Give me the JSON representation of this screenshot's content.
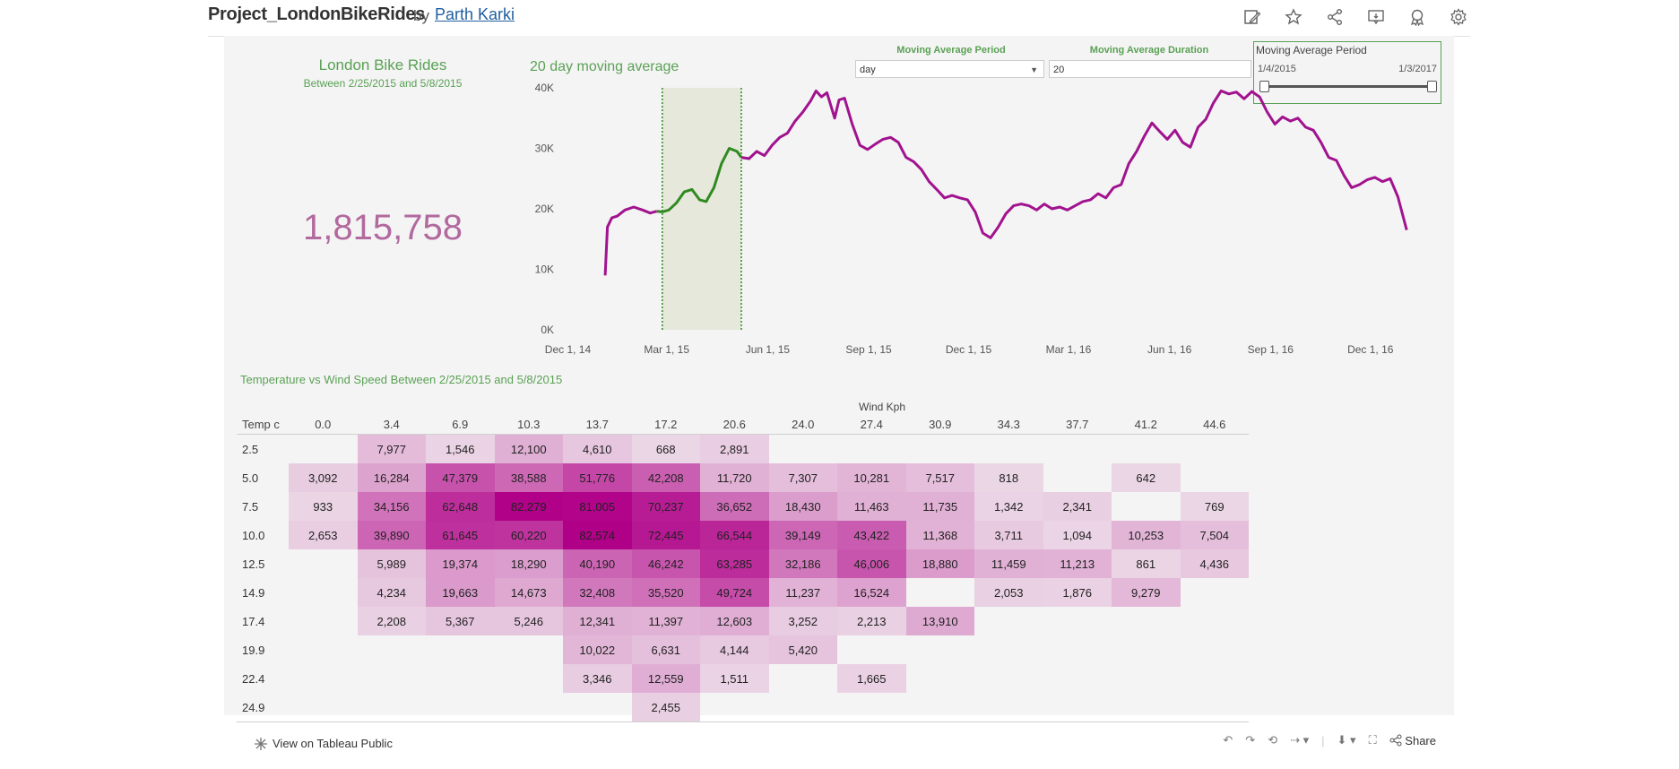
{
  "topbar": {
    "title": "Project_LondonBikeRides",
    "by": "by",
    "author": "Parth Karki"
  },
  "kpi": {
    "title": "London Bike Rides",
    "subtitle": "Between 2/25/2015 and 5/8/2015",
    "value": "1,815,758"
  },
  "line_title": "20 day moving average",
  "controls": {
    "period_label": "Moving Average Period",
    "period_value": "day",
    "duration_label": "Moving Average Duration",
    "duration_value": "20",
    "range_label": "Moving Average Period",
    "range_start": "1/4/2015",
    "range_end": "1/3/2017"
  },
  "heatmap": {
    "title": "Temperature vs Wind Speed Between 2/25/2015 and 5/8/2015",
    "col_header_label": "Wind Kph",
    "row_header_label": "Temp c"
  },
  "footer": {
    "view_label": "View on Tableau Public",
    "share_label": "Share"
  },
  "icons": [
    "edit-icon",
    "star-icon",
    "share-icon",
    "comment-icon",
    "badge-icon",
    "gear-icon"
  ],
  "colors": {
    "green": "#5aa155",
    "line_purple": "#a1128f",
    "highlight_green": "#2f8a1f",
    "kpi_purple": "#b2699e"
  },
  "chart_data": [
    {
      "type": "line",
      "title": "20 day moving average",
      "x_ticks": [
        "Dec 1, 14",
        "Mar 1, 15",
        "Jun 1, 15",
        "Sep 1, 15",
        "Dec 1, 15",
        "Mar 1, 16",
        "Jun 1, 16",
        "Sep 1, 16",
        "Dec 1, 16"
      ],
      "y_ticks": [
        "0K",
        "10K",
        "20K",
        "30K",
        "40K"
      ],
      "ylim": [
        0,
        40000
      ],
      "x_range": [
        "2014-11-20",
        "2017-01-20"
      ],
      "highlight": {
        "start": "2015-02-25",
        "end": "2015-05-08"
      },
      "series": [
        {
          "values": [
            [
              "2015-01-04",
              9000
            ],
            [
              "2015-01-06",
              17000
            ],
            [
              "2015-01-10",
              18500
            ],
            [
              "2015-01-15",
              18800
            ],
            [
              "2015-01-22",
              19800
            ],
            [
              "2015-01-30",
              20300
            ],
            [
              "2015-02-07",
              19800
            ],
            [
              "2015-02-14",
              19300
            ],
            [
              "2015-02-20",
              19600
            ],
            [
              "2015-02-25",
              19500
            ],
            [
              "2015-03-03",
              19800
            ],
            [
              "2015-03-10",
              21000
            ],
            [
              "2015-03-17",
              22800
            ],
            [
              "2015-03-24",
              23200
            ],
            [
              "2015-03-31",
              21500
            ],
            [
              "2015-04-06",
              21200
            ],
            [
              "2015-04-13",
              23500
            ],
            [
              "2015-04-20",
              27500
            ],
            [
              "2015-04-27",
              30000
            ],
            [
              "2015-05-04",
              29500
            ],
            [
              "2015-05-08",
              28500
            ],
            [
              "2015-05-15",
              28300
            ],
            [
              "2015-05-22",
              29500
            ],
            [
              "2015-05-29",
              28800
            ],
            [
              "2015-06-05",
              30500
            ],
            [
              "2015-06-12",
              31800
            ],
            [
              "2015-06-19",
              32500
            ],
            [
              "2015-06-26",
              34500
            ],
            [
              "2015-07-03",
              36000
            ],
            [
              "2015-07-10",
              37800
            ],
            [
              "2015-07-15",
              39500
            ],
            [
              "2015-07-20",
              38500
            ],
            [
              "2015-07-25",
              39200
            ],
            [
              "2015-08-01",
              35000
            ],
            [
              "2015-08-05",
              38000
            ],
            [
              "2015-08-10",
              38300
            ],
            [
              "2015-08-17",
              34000
            ],
            [
              "2015-08-24",
              30500
            ],
            [
              "2015-08-31",
              29800
            ],
            [
              "2015-09-07",
              30700
            ],
            [
              "2015-09-14",
              31500
            ],
            [
              "2015-09-21",
              31800
            ],
            [
              "2015-09-28",
              31000
            ],
            [
              "2015-10-05",
              28500
            ],
            [
              "2015-10-12",
              27800
            ],
            [
              "2015-10-19",
              26500
            ],
            [
              "2015-10-26",
              24500
            ],
            [
              "2015-11-02",
              23200
            ],
            [
              "2015-11-09",
              21800
            ],
            [
              "2015-11-16",
              22200
            ],
            [
              "2015-11-23",
              21800
            ],
            [
              "2015-11-30",
              21500
            ],
            [
              "2015-12-07",
              19500
            ],
            [
              "2015-12-14",
              16000
            ],
            [
              "2015-12-21",
              15200
            ],
            [
              "2015-12-28",
              17000
            ],
            [
              "2016-01-04",
              19200
            ],
            [
              "2016-01-11",
              20500
            ],
            [
              "2016-01-18",
              20800
            ],
            [
              "2016-01-25",
              20500
            ],
            [
              "2016-02-01",
              19800
            ],
            [
              "2016-02-08",
              20800
            ],
            [
              "2016-02-15",
              20000
            ],
            [
              "2016-02-22",
              20300
            ],
            [
              "2016-02-29",
              19800
            ],
            [
              "2016-03-07",
              20500
            ],
            [
              "2016-03-14",
              21200
            ],
            [
              "2016-03-21",
              21500
            ],
            [
              "2016-03-28",
              22500
            ],
            [
              "2016-04-04",
              21800
            ],
            [
              "2016-04-11",
              23500
            ],
            [
              "2016-04-18",
              24000
            ],
            [
              "2016-04-25",
              27500
            ],
            [
              "2016-05-02",
              29500
            ],
            [
              "2016-05-09",
              32000
            ],
            [
              "2016-05-16",
              34200
            ],
            [
              "2016-05-23",
              32800
            ],
            [
              "2016-05-30",
              31500
            ],
            [
              "2016-06-06",
              33000
            ],
            [
              "2016-06-13",
              31000
            ],
            [
              "2016-06-20",
              30200
            ],
            [
              "2016-06-27",
              33500
            ],
            [
              "2016-07-04",
              34800
            ],
            [
              "2016-07-11",
              37500
            ],
            [
              "2016-07-18",
              39500
            ],
            [
              "2016-07-25",
              39000
            ],
            [
              "2016-08-01",
              39300
            ],
            [
              "2016-08-08",
              38200
            ],
            [
              "2016-08-15",
              39400
            ],
            [
              "2016-08-22",
              38500
            ],
            [
              "2016-08-29",
              36000
            ],
            [
              "2016-09-05",
              34000
            ],
            [
              "2016-09-12",
              35200
            ],
            [
              "2016-09-19",
              34500
            ],
            [
              "2016-09-26",
              35000
            ],
            [
              "2016-10-03",
              33500
            ],
            [
              "2016-10-10",
              33000
            ],
            [
              "2016-10-17",
              31000
            ],
            [
              "2016-10-24",
              28500
            ],
            [
              "2016-10-31",
              28000
            ],
            [
              "2016-11-07",
              25500
            ],
            [
              "2016-11-14",
              23500
            ],
            [
              "2016-11-21",
              24000
            ],
            [
              "2016-11-28",
              24800
            ],
            [
              "2016-12-05",
              25200
            ],
            [
              "2016-12-12",
              24500
            ],
            [
              "2016-12-19",
              25000
            ],
            [
              "2016-12-26",
              22000
            ],
            [
              "2017-01-03",
              16500
            ]
          ]
        }
      ]
    },
    {
      "type": "heatmap",
      "title": "Temperature vs Wind Speed Between 2/25/2015 and 5/8/2015",
      "xlabel": "Wind Kph",
      "ylabel": "Temp c",
      "x": [
        "0.0",
        "3.4",
        "6.9",
        "10.3",
        "13.7",
        "17.2",
        "20.6",
        "24.0",
        "27.4",
        "30.9",
        "34.3",
        "37.7",
        "41.2",
        "44.6"
      ],
      "y": [
        "2.5",
        "5.0",
        "7.5",
        "10.0",
        "12.5",
        "14.9",
        "17.4",
        "19.9",
        "22.4",
        "24.9"
      ],
      "values": [
        [
          null,
          7977,
          1546,
          12100,
          4610,
          668,
          2891,
          null,
          null,
          null,
          null,
          null,
          null,
          null
        ],
        [
          3092,
          16284,
          47379,
          38588,
          51776,
          42208,
          11720,
          7307,
          10281,
          7517,
          818,
          null,
          642,
          null
        ],
        [
          933,
          34156,
          62648,
          82279,
          81005,
          70237,
          36652,
          18430,
          11463,
          11735,
          1342,
          2341,
          null,
          769
        ],
        [
          2653,
          39890,
          61645,
          60220,
          82574,
          72445,
          66544,
          39149,
          43422,
          11368,
          3711,
          1094,
          10253,
          7504
        ],
        [
          null,
          5989,
          19374,
          18290,
          40190,
          46242,
          63285,
          32186,
          46006,
          18880,
          11459,
          11213,
          861,
          4436
        ],
        [
          null,
          4234,
          19663,
          14673,
          32408,
          35520,
          49724,
          11237,
          16524,
          null,
          2053,
          1876,
          9279,
          null
        ],
        [
          null,
          2208,
          5367,
          5246,
          12341,
          11397,
          12603,
          3252,
          2213,
          13910,
          null,
          null,
          null,
          null
        ],
        [
          null,
          null,
          null,
          null,
          10022,
          6631,
          4144,
          5420,
          null,
          null,
          null,
          null,
          null,
          null
        ],
        [
          null,
          null,
          null,
          null,
          3346,
          12559,
          1511,
          null,
          1665,
          null,
          null,
          null,
          null,
          null
        ],
        [
          null,
          null,
          null,
          null,
          null,
          2455,
          null,
          null,
          null,
          null,
          null,
          null,
          null,
          null
        ]
      ],
      "labels": [
        [
          null,
          "7,977",
          "1,546",
          "12,100",
          "4,610",
          "668",
          "2,891",
          null,
          null,
          null,
          null,
          null,
          null,
          null
        ],
        [
          "3,092",
          "16,284",
          "47,379",
          "38,588",
          "51,776",
          "42,208",
          "11,720",
          "7,307",
          "10,281",
          "7,517",
          "818",
          null,
          "642",
          null
        ],
        [
          "933",
          "34,156",
          "62,648",
          "82,279",
          "81,005",
          "70,237",
          "36,652",
          "18,430",
          "11,463",
          "11,735",
          "1,342",
          "2,341",
          null,
          "769"
        ],
        [
          "2,653",
          "39,890",
          "61,645",
          "60,220",
          "82,574",
          "72,445",
          "66,544",
          "39,149",
          "43,422",
          "11,368",
          "3,711",
          "1,094",
          "10,253",
          "7,504"
        ],
        [
          null,
          "5,989",
          "19,374",
          "18,290",
          "40,190",
          "46,242",
          "63,285",
          "32,186",
          "46,006",
          "18,880",
          "11,459",
          "11,213",
          "861",
          "4,436"
        ],
        [
          null,
          "4,234",
          "19,663",
          "14,673",
          "32,408",
          "35,520",
          "49,724",
          "11,237",
          "16,524",
          null,
          "2,053",
          "1,876",
          "9,279",
          null
        ],
        [
          null,
          "2,208",
          "5,367",
          "5,246",
          "12,341",
          "11,397",
          "12,603",
          "3,252",
          "2,213",
          "13,910",
          null,
          null,
          null,
          null
        ],
        [
          null,
          null,
          null,
          null,
          "10,022",
          "6,631",
          "4,144",
          "5,420",
          null,
          null,
          null,
          null,
          null,
          null
        ],
        [
          null,
          null,
          null,
          null,
          "3,346",
          "12,559",
          "1,511",
          null,
          "1,665",
          null,
          null,
          null,
          null,
          null
        ],
        [
          null,
          null,
          null,
          null,
          null,
          "2,455",
          null,
          null,
          null,
          null,
          null,
          null,
          null,
          null
        ]
      ]
    }
  ]
}
